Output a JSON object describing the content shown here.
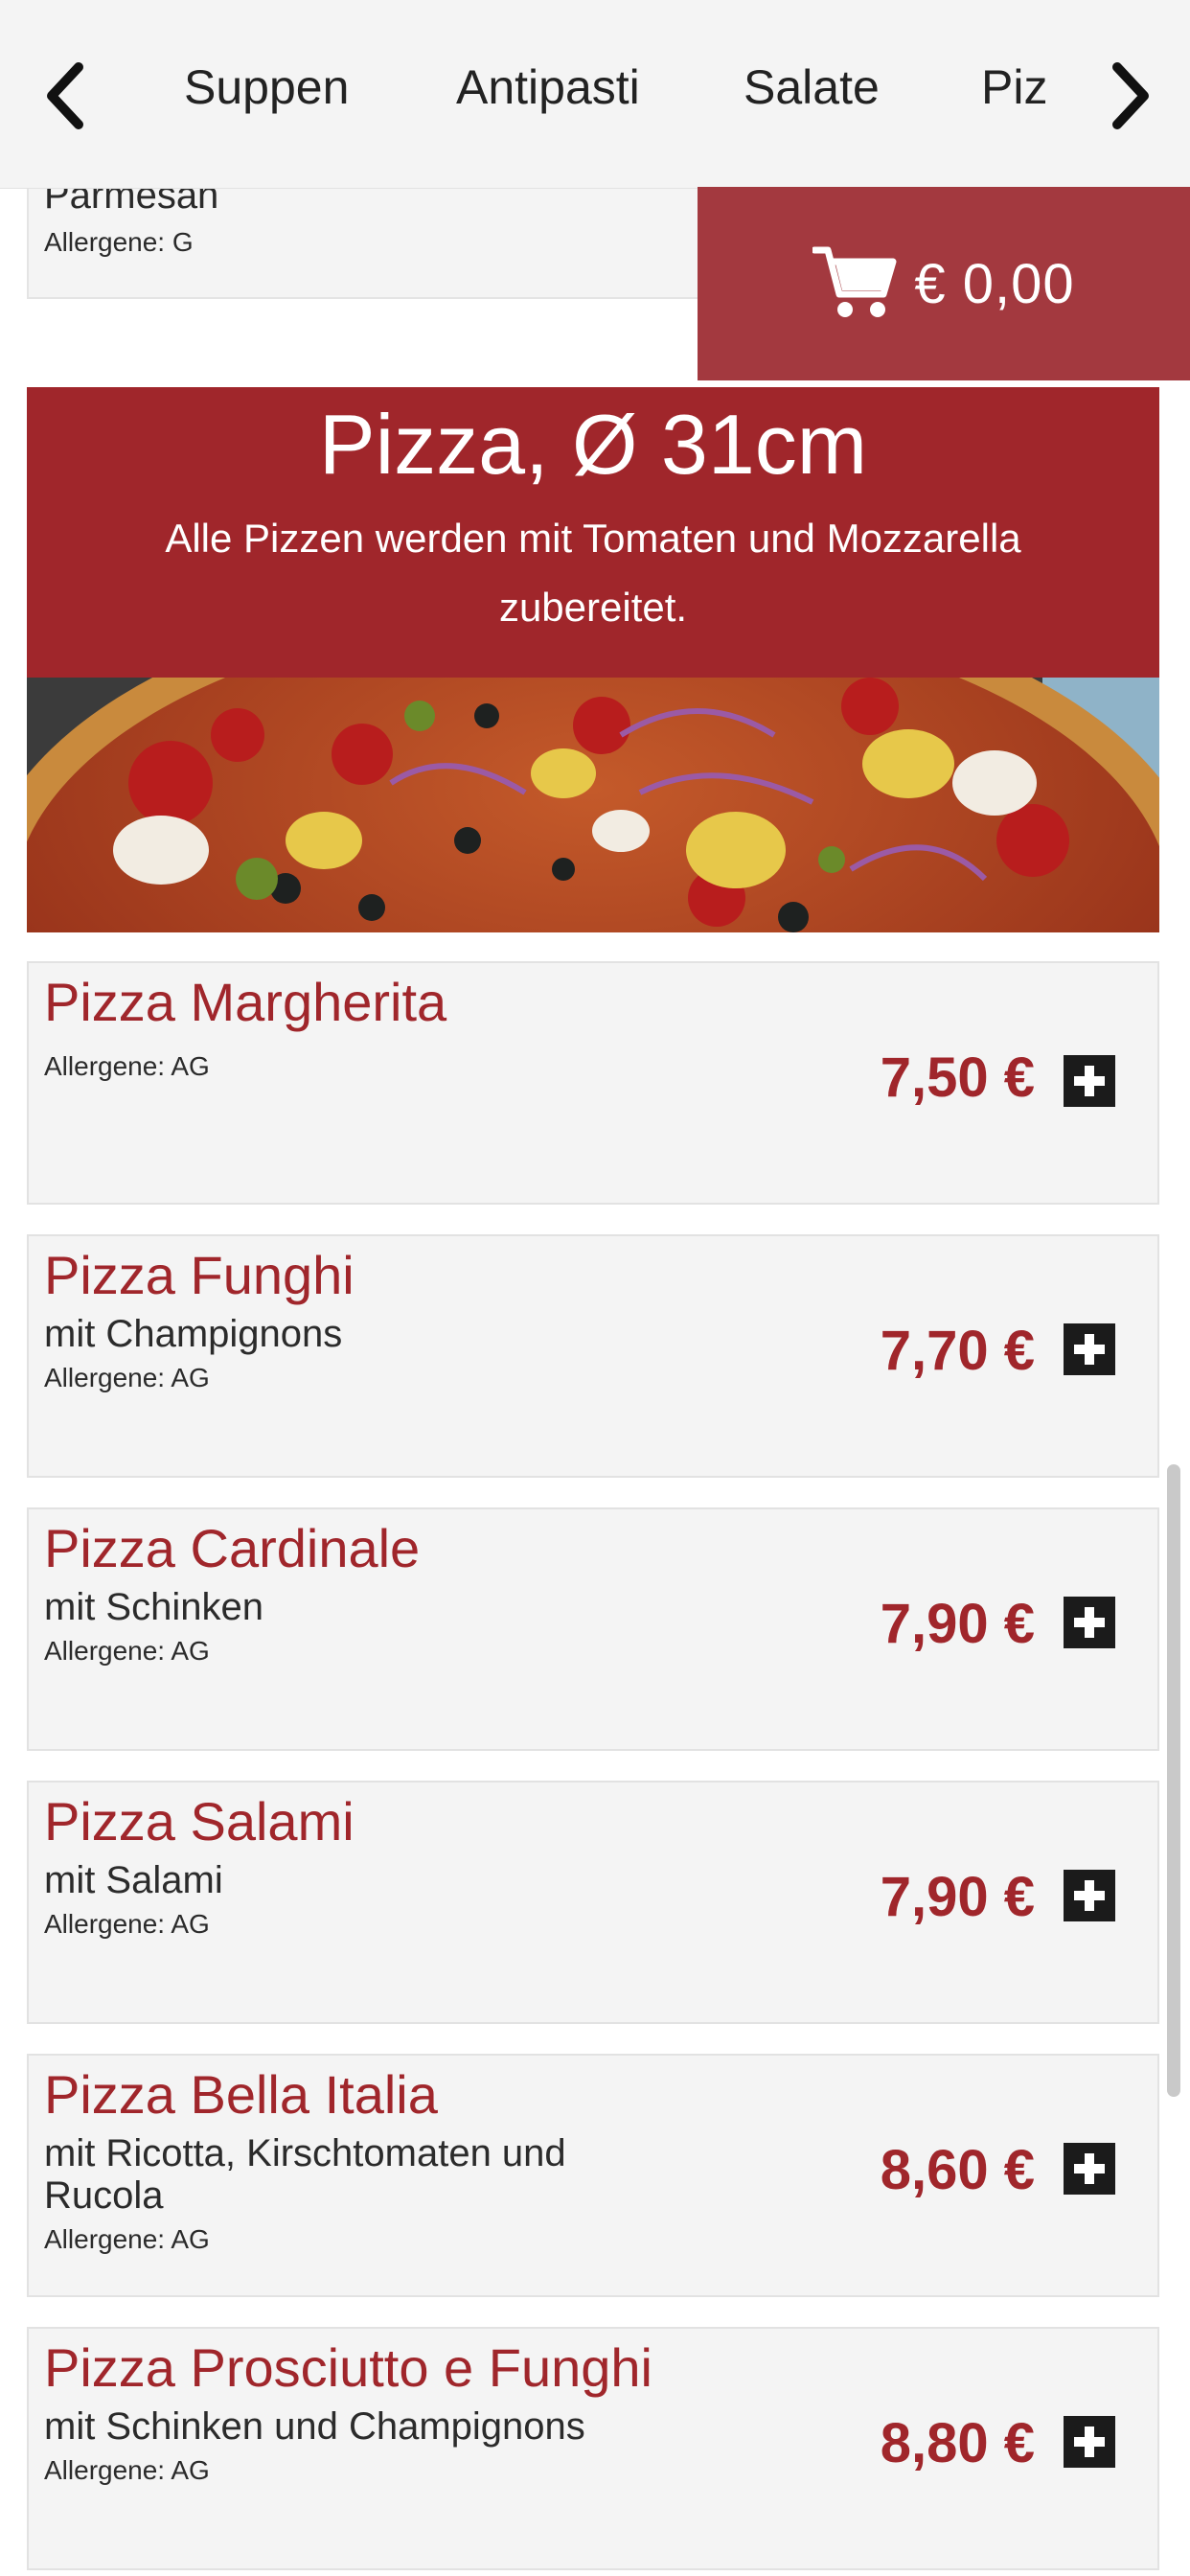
{
  "nav": {
    "categories": [
      "Suppen",
      "Antipasti",
      "Salate",
      "Piz"
    ],
    "prev_icon": "chevron-left-icon",
    "next_icon": "chevron-right-icon"
  },
  "previous_item": {
    "name": "Parmesan",
    "allergens": "Allergene: G"
  },
  "cart": {
    "icon": "shopping-cart-icon",
    "amount": "€ 0,00"
  },
  "section": {
    "title": "Pizza, Ø 31cm",
    "description": "Alle Pizzen werden mit Tomaten und Mozzarella zubereitet."
  },
  "items": [
    {
      "name": "Pizza Margherita",
      "description": "",
      "allergens": "Allergene: AG",
      "price": "7,50 €"
    },
    {
      "name": "Pizza Funghi",
      "description": "mit Champignons",
      "allergens": "Allergene: AG",
      "price": "7,70 €"
    },
    {
      "name": "Pizza Cardinale",
      "description": "mit Schinken",
      "allergens": "Allergene: AG",
      "price": "7,90 €"
    },
    {
      "name": "Pizza Salami",
      "description": "mit Salami",
      "allergens": "Allergene: AG",
      "price": "7,90 €"
    },
    {
      "name": "Pizza Bella Italia",
      "description": "mit Ricotta, Kirschtomaten und Rucola",
      "allergens": "Allergene: AG",
      "price": "8,60 €"
    },
    {
      "name": "Pizza Prosciutto e Funghi",
      "description": "mit Schinken und Champignons",
      "allergens": "Allergene: AG",
      "price": "8,80 €"
    }
  ],
  "colors": {
    "brand_red": "#a0262b",
    "cart_red": "#a3393f",
    "card_bg": "#f4f4f4"
  }
}
